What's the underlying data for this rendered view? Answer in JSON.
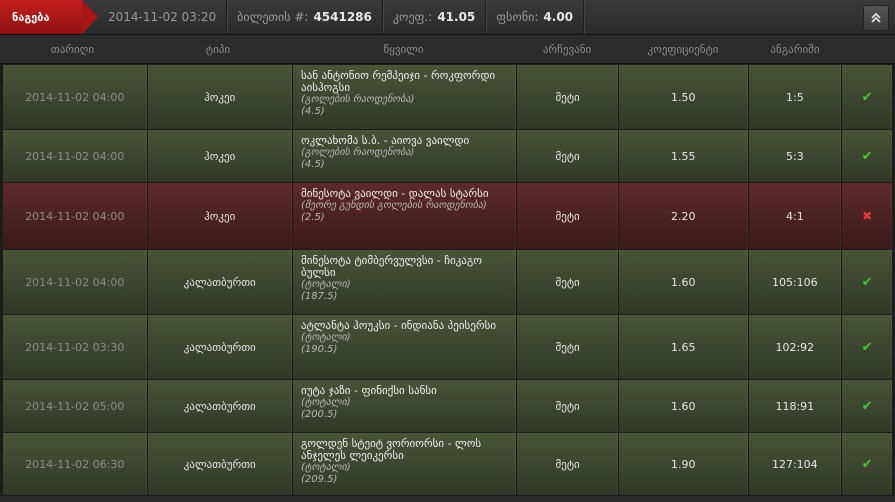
{
  "topbar": {
    "tag": "ნაგება",
    "date": "2014-11-02 03:20",
    "ticket_label": "ბილეთის #:",
    "ticket_value": "4541286",
    "coef_label": "კოეფ.:",
    "coef_value": "41.05",
    "bonus_label": "ფსონი:",
    "bonus_value": "4.00",
    "collapse_icon": "chevron-double-up-icon"
  },
  "columns": [
    "თარიღი",
    "ტიპი",
    "წყვილი",
    "არჩევანი",
    "კოეფიციენტი",
    "ანგარიში",
    ""
  ],
  "rows": [
    {
      "date": "2014-11-02 04:00",
      "type": "ჰოკეი",
      "title": "სან ანტონიო რემპეიჯი - როკფორდი აისჰოგსი",
      "market": "(გოლების რაოდენობა)",
      "line": "(4.5)",
      "pick": "მეტი",
      "coef": "1.50",
      "score": "1:5",
      "status": "win"
    },
    {
      "date": "2014-11-02 04:00",
      "type": "ჰოკეი",
      "title": "ოკლახომა ს.ბ. - აიოვა ვაილდი",
      "market": "(გოლების რაოდენობა)",
      "line": "(4.5)",
      "pick": "მეტი",
      "coef": "1.55",
      "score": "5:3",
      "status": "win"
    },
    {
      "date": "2014-11-02 04:00",
      "type": "ჰოკეი",
      "title": "მინესოტა ვაილდი - დალას სტარსი",
      "market": "(მეორე გუნდის გოლების რაოდენობა)",
      "line": "(2.5)",
      "pick": "მეტი",
      "coef": "2.20",
      "score": "4:1",
      "status": "loss"
    },
    {
      "date": "2014-11-02 04:00",
      "type": "კალათბურთი",
      "title": "მინესოტა ტიმბერვულვსი - ჩიკაგო ბულსი",
      "market": "(ტოტალი)",
      "line": "(187.5)",
      "pick": "მეტი",
      "coef": "1.60",
      "score": "105:106",
      "status": "win"
    },
    {
      "date": "2014-11-02 03:30",
      "type": "კალათბურთი",
      "title": "ატლანტა ჰოუკსი - ინდიანა პეისერსი",
      "market": "(ტოტალი)",
      "line": "(190.5)",
      "pick": "მეტი",
      "coef": "1.65",
      "score": "102:92",
      "status": "win"
    },
    {
      "date": "2014-11-02 05:00",
      "type": "კალათბურთი",
      "title": "იუტა ჯაზი - ფინიქსი სანსი",
      "market": "(ტოტალი)",
      "line": "(200.5)",
      "pick": "მეტი",
      "coef": "1.60",
      "score": "118:91",
      "status": "win"
    },
    {
      "date": "2014-11-02 06:30",
      "type": "კალათბურთი",
      "title": "გოლდენ სტეიტ ვორიორსი - ლოს ანჯელეს ლეიკერსი",
      "market": "(ტოტალი)",
      "line": "(209.5)",
      "pick": "მეტი",
      "coef": "1.90",
      "score": "127:104",
      "status": "win"
    }
  ],
  "icons": {
    "win": "check-icon",
    "loss": "cross-icon"
  }
}
